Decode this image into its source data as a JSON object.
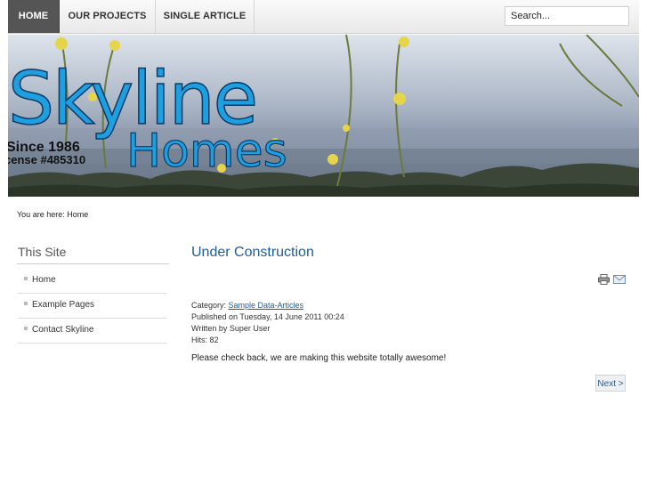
{
  "nav": {
    "items": [
      {
        "label": "HOME"
      },
      {
        "label": "OUR PROJECTS"
      },
      {
        "label": "SINGLE ARTICLE"
      }
    ],
    "search_value": "Search..."
  },
  "banner": {
    "logo_word1": "Skyline",
    "logo_word2": "Homes",
    "since": "Since 1986",
    "license": "cense #485310"
  },
  "breadcrumb": "You are here: Home",
  "sidebar": {
    "title": "This Site",
    "items": [
      {
        "label": "Home"
      },
      {
        "label": "Example Pages"
      },
      {
        "label": "Contact Skyline"
      }
    ]
  },
  "article": {
    "title": "Under Construction",
    "category_label": "Category: ",
    "category_link": "Sample Data-Articles",
    "published": "Published on Tuesday, 14 June 2011 00:24",
    "written_by": "Written by Super User",
    "hits": "Hits: 82",
    "body": "Please check back, we are making this website totally awesome!",
    "next_label": "Next >"
  },
  "icons": {
    "print": "print-icon",
    "email": "email-icon"
  },
  "colors": {
    "link": "#1e5c98",
    "nav_active": "#555555",
    "logo_blue": "#1ea0e0"
  }
}
